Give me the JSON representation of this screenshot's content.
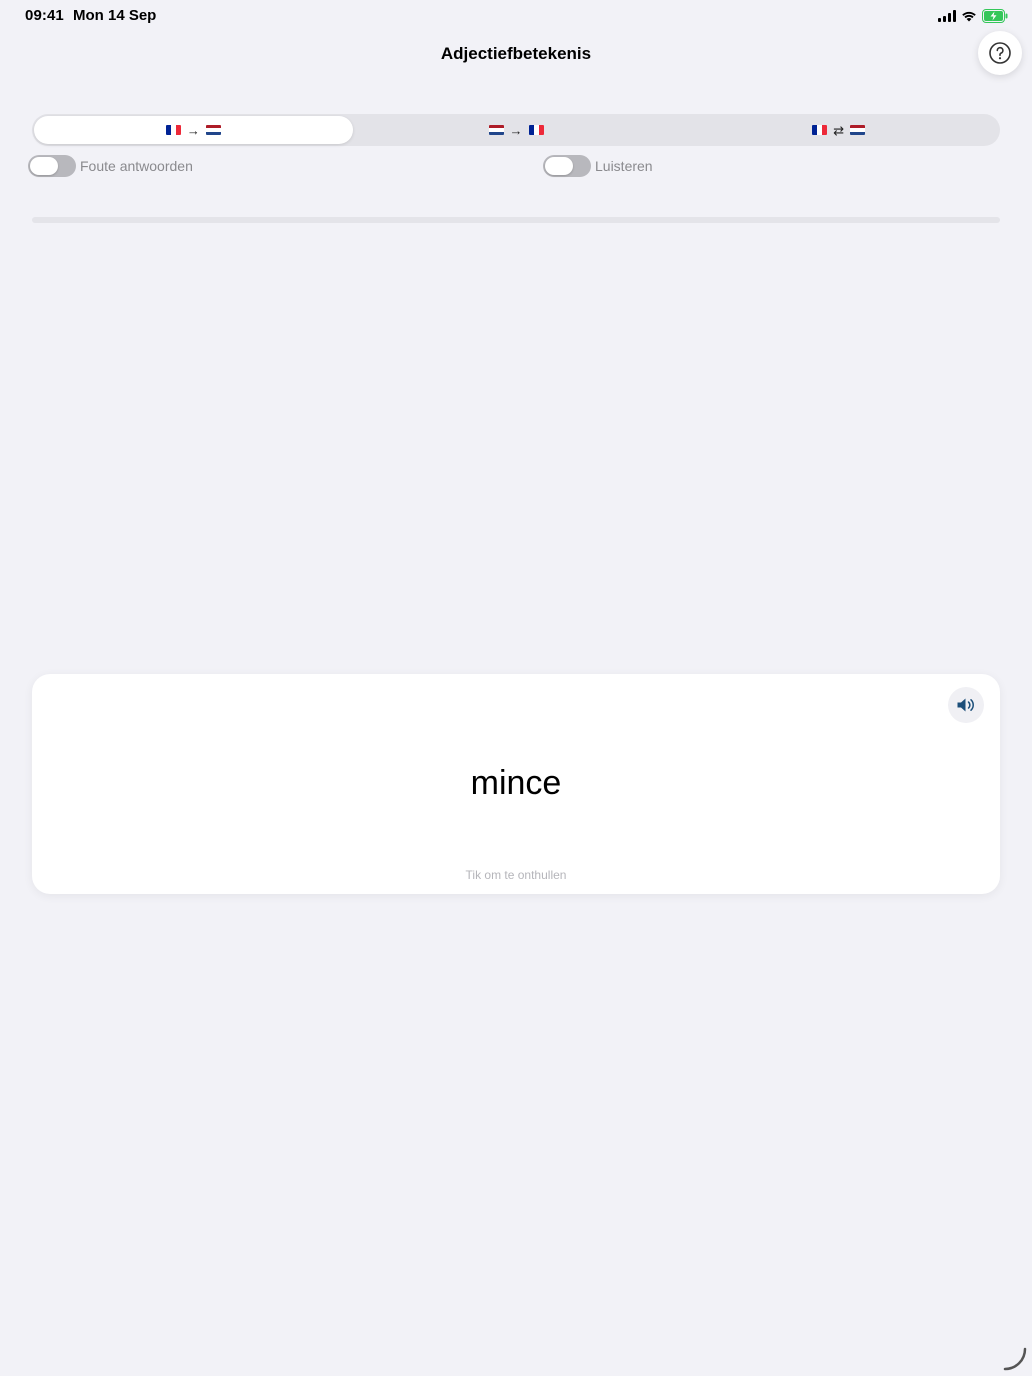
{
  "status_bar": {
    "time": "09:41",
    "date": "Mon 14 Sep",
    "battery_color": "#34c759"
  },
  "nav": {
    "title": "Adjectiefbetekenis",
    "help_icon": "question-circle-icon"
  },
  "direction_picker": {
    "selected_index": 0,
    "segments": [
      {
        "from_flag": "flag-fr-icon",
        "arrow": "→",
        "to_flag": "flag-nl-icon"
      },
      {
        "from_flag": "flag-nl-icon",
        "arrow": "→",
        "to_flag": "flag-fr-icon"
      },
      {
        "from_flag": "flag-fr-icon",
        "arrow": "⇄",
        "to_flag": "flag-nl-icon"
      }
    ]
  },
  "toggles": {
    "wrong_answers": {
      "label": "Foute antwoorden",
      "on": false
    },
    "listen": {
      "label": "Luisteren",
      "on": false
    }
  },
  "progress": {
    "fraction": 0
  },
  "card": {
    "word": "mince",
    "hint": "Tik om te onthullen",
    "speaker_icon": "speaker-icon",
    "speaker_color": "#1c4f7a"
  },
  "colors": {
    "background": "#f2f2f7",
    "accent": "#007aff",
    "flag_fr": [
      "#002395",
      "#ffffff",
      "#ed2939"
    ],
    "flag_nl": [
      "#ae1c28",
      "#ffffff",
      "#21468b"
    ]
  }
}
